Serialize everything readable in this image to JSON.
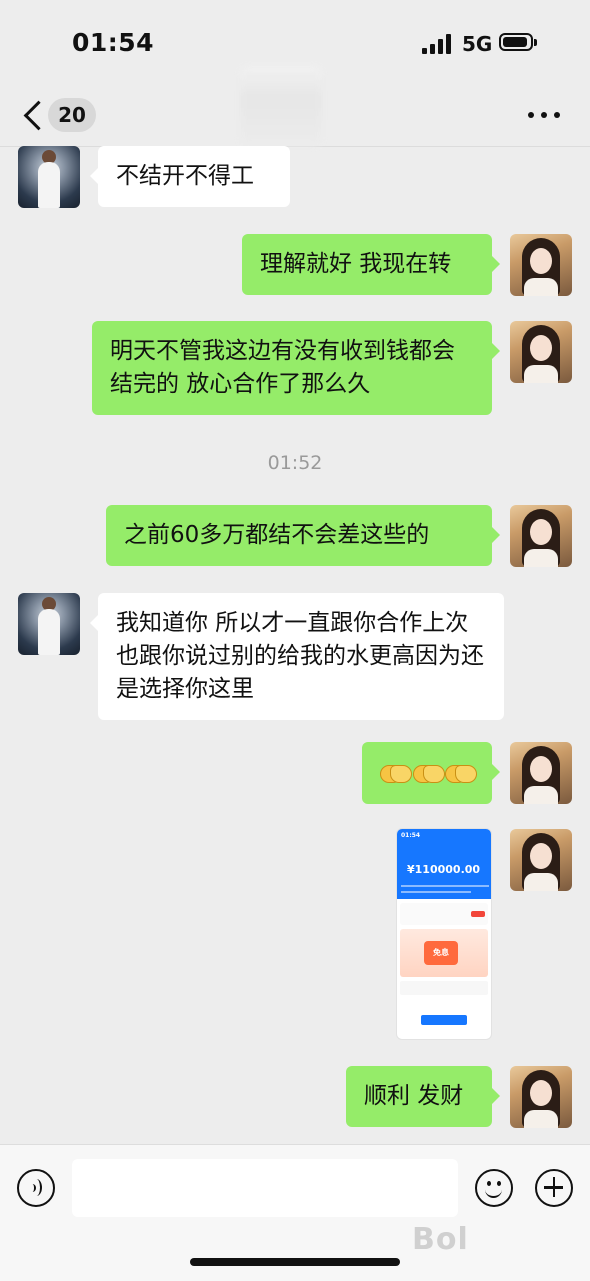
{
  "status_bar": {
    "time": "01:54",
    "network": "5G"
  },
  "nav": {
    "unread_count": "20"
  },
  "messages": [
    {
      "side": "left",
      "text": "不结开不得工"
    },
    {
      "side": "right",
      "text": "理解就好 我现在转"
    },
    {
      "side": "right",
      "text": "明天不管我这边有没有收到钱都会结完的 放心合作了那么久"
    },
    {
      "side": "timestamp",
      "text": "01:52"
    },
    {
      "side": "right",
      "text": "之前60多万都结不会差这些的"
    },
    {
      "side": "left",
      "text": "我知道你 所以才一直跟你合作上次也跟你说过别的给我的水更高因为还是选择你这里"
    },
    {
      "side": "right",
      "emoji": [
        "handshake",
        "handshake",
        "handshake"
      ]
    },
    {
      "side": "right",
      "image": {
        "time": "01:54",
        "amount": "¥110000.00",
        "promo_label": "免息"
      }
    },
    {
      "side": "right",
      "text": "顺利 发财"
    }
  ],
  "input_bar": {
    "placeholder": ""
  },
  "watermark": "Bol"
}
